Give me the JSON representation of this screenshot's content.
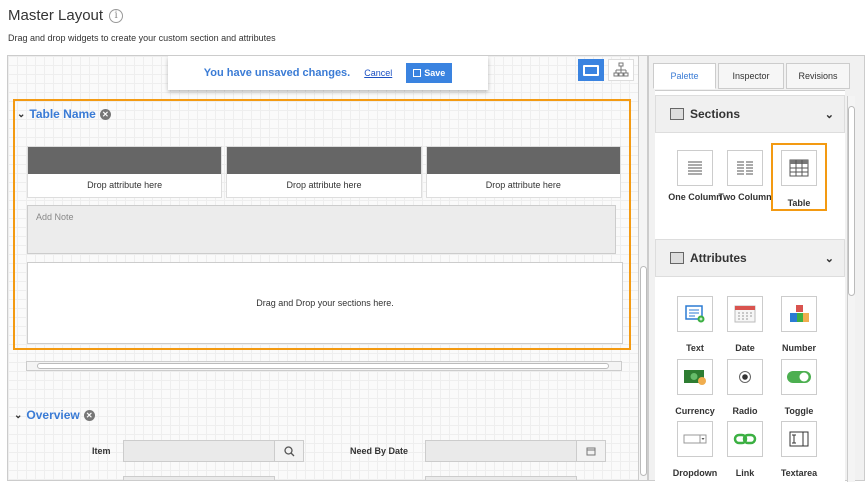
{
  "page": {
    "title": "Master Layout",
    "subtitle": "Drag and drop widgets to create your custom section and attributes"
  },
  "toolbar": {
    "unsaved_message": "You have unsaved changes.",
    "cancel_label": "Cancel",
    "save_label": "Save"
  },
  "table_section": {
    "title": "Table Name",
    "columns": [
      "Drop attribute here",
      "Drop attribute here",
      "Drop attribute here"
    ],
    "note_placeholder": "Add Note",
    "drop_zone_text": "Drag and Drop your sections here."
  },
  "overview": {
    "title": "Overview",
    "fields": [
      {
        "label": "Item"
      },
      {
        "label": "Need By Date"
      }
    ]
  },
  "panel": {
    "tabs": [
      "Palette",
      "Inspector",
      "Revisions"
    ],
    "active_tab": "Palette",
    "sections_title": "Sections",
    "sections": [
      {
        "label": "One Column",
        "icon": "one-column-icon"
      },
      {
        "label": "Two Column",
        "icon": "two-column-icon"
      },
      {
        "label": "Table",
        "icon": "table-icon"
      }
    ],
    "attributes_title": "Attributes",
    "attributes": [
      {
        "label": "Text",
        "icon": "text-icon"
      },
      {
        "label": "Date",
        "icon": "date-icon"
      },
      {
        "label": "Number",
        "icon": "number-icon"
      },
      {
        "label": "Currency",
        "icon": "currency-icon"
      },
      {
        "label": "Radio",
        "icon": "radio-icon"
      },
      {
        "label": "Toggle",
        "icon": "toggle-icon"
      },
      {
        "label": "Dropdown",
        "icon": "dropdown-icon"
      },
      {
        "label": "Link",
        "icon": "link-icon"
      },
      {
        "label": "Textarea",
        "icon": "textarea-icon"
      }
    ]
  },
  "colors": {
    "accent": "#3a7bd5",
    "highlight": "#f39a12",
    "button": "#3a83e0"
  }
}
